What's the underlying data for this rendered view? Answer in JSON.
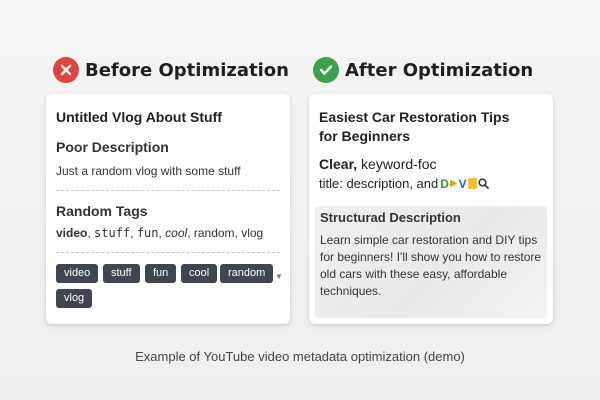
{
  "before": {
    "heading": "Before Optimization",
    "title": "Untitled Vlog About Stuff",
    "desc_heading": "Poor Description",
    "desc_text": "Just a random vlog with some stuff",
    "tags_heading": "Random Tags",
    "tags_line": [
      "video",
      "stuff",
      "fun",
      "cool",
      "random",
      "vlog"
    ],
    "chips": [
      "video",
      "stuff",
      "fun",
      "cool",
      "random",
      "vlog"
    ],
    "status_color": "#e1443f"
  },
  "after": {
    "heading": "After Optimization",
    "title": "Easiest Car Restoration Tips for Beginners",
    "clear_label": "Clear,",
    "clear_rest": "keyword-foc",
    "title_line": "title: description, and",
    "desc_heading": "Structurad Description",
    "desc_text": "Learn simple car restoration and DIY tips for beginners! I'll show you how to restore old cars with these easy, affordable techniques.",
    "status_color": "#3aa24a"
  },
  "caption": "Example of YouTube video metadata optimization (demo)"
}
